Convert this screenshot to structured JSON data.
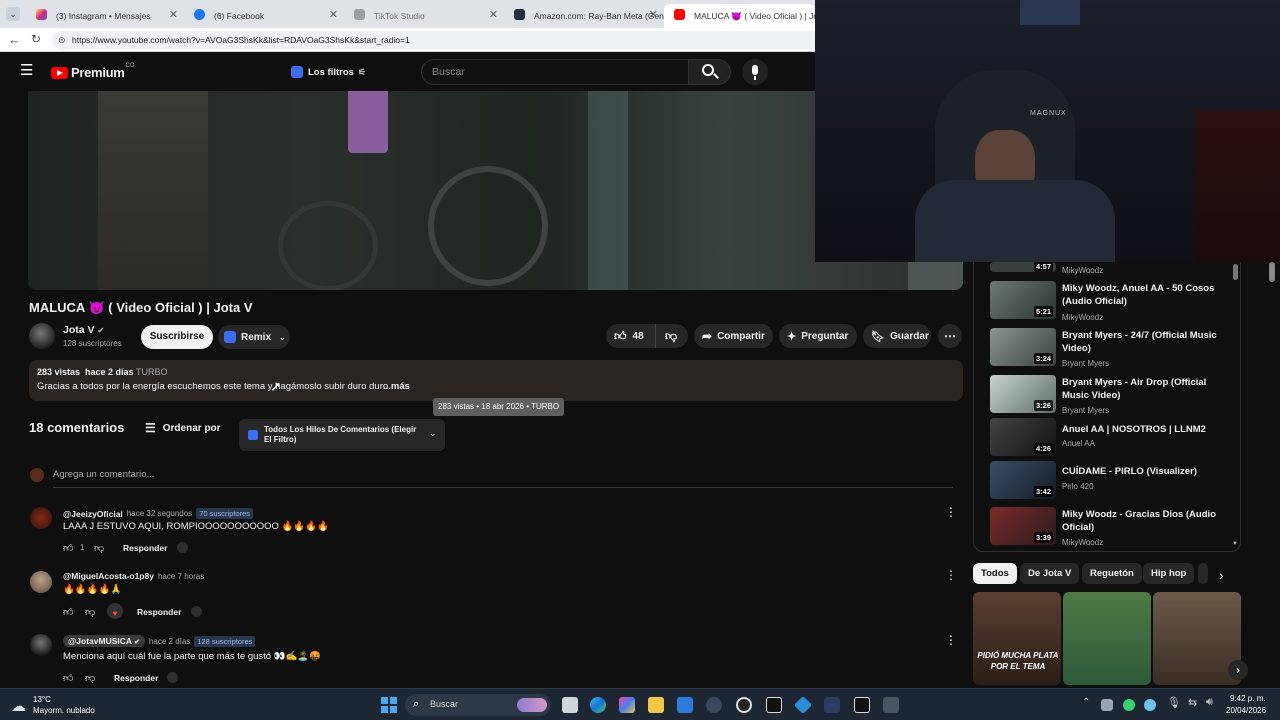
{
  "browser": {
    "tabs": [
      {
        "label": "(3) Instagram • Mensajes",
        "color": "#e1306c"
      },
      {
        "label": "(6) Facebook",
        "color": "#1877f2"
      },
      {
        "label": "TikTok Studio",
        "color": "#777777"
      },
      {
        "label": "Amazon.com: Ray-Ban Meta (Gen",
        "color": "#111111"
      },
      {
        "label": "MALUCA 😈 ( Video Oficial ) | Jota",
        "color": "#ff0000"
      }
    ],
    "url": "https://www.youtube.com/watch?v=AVOaG3ShsKk&list=RDAVOaG3ShsKk&start_radio=1"
  },
  "header": {
    "logo_text": "Premium",
    "logo_sup": "CO",
    "filter_label": "Los filtros",
    "search_placeholder": "Buscar"
  },
  "video": {
    "title": "MALUCA 😈 ( Video Oficial ) | Jota V",
    "channel": "Jota V",
    "subscribers": "128 suscriptores",
    "subscribe_label": "Suscribirse",
    "remix_label": "Remix",
    "likes": "48",
    "share_label": "Compartir",
    "ask_label": "Preguntar",
    "save_label": "Guardar"
  },
  "description": {
    "stats": "283 vistas  hace 2 días",
    "tag": "TURBO",
    "text": "Gracias a todos por la energía escuchemos este tema y hagámoslo subir duro duro",
    "more": "...más",
    "tooltip": "283 vistas • 18 abr 2026 • TURBO"
  },
  "comments_section": {
    "count_label": "18 comentarios",
    "sort_label": "Ordenar por",
    "filter_label": "Todos Los Hilos De Comentarios (Elegir El Filtro)",
    "add_placeholder": "Agrega un comentario...",
    "reply_label": "Responder",
    "items": [
      {
        "author": "@JeeizyOficial",
        "time": "hace 32 segundos",
        "badge": "70 suscriptores",
        "text": "LAAA J ESTUVO AQUI, ROMPIOOOOOOOOOOO 🔥🔥🔥🔥",
        "likes": "1"
      },
      {
        "author": "@MiguelAcosta-o1p8y",
        "time": "hace 7 horas",
        "badge": "",
        "text": "🔥🔥🔥🔥🙏",
        "likes": ""
      },
      {
        "author": "@JotavMUSICA",
        "time": "hace 2 días",
        "badge": "128 suscriptores",
        "text": "Menciona aquí cuál fue la parte que más te gustó 👀✍️🏝️🤬",
        "likes": ""
      }
    ]
  },
  "sidebar": {
    "items": [
      {
        "title": "",
        "channel": "MikyWoodz",
        "duration": "4:57"
      },
      {
        "title": "Miky Woodz, Anuel AA - 50 Cosos (Audio Oficial)",
        "channel": "MikyWoodz",
        "duration": "5:21"
      },
      {
        "title": "Bryant Myers - 24/7 (Official Music Video)",
        "channel": "Bryant Myers",
        "duration": "3:24"
      },
      {
        "title": "Bryant Myers - Air Drop (Official Music Video)",
        "channel": "Bryant Myers",
        "duration": "3:26"
      },
      {
        "title": "Anuel AA | NOSOTROS | LLNM2",
        "channel": "Anuel AA",
        "duration": "4:26"
      },
      {
        "title": "CUÍDAME - PIRLO (Visualizer)",
        "channel": "Pirlo 420",
        "duration": "3:42"
      },
      {
        "title": "Miky Woodz - Gracias Dios (Audio Oficial)",
        "channel": "MikyWoodz",
        "duration": "3:39"
      }
    ],
    "chips": [
      "Todos",
      "De Jota V",
      "Reguetón",
      "Hip hop"
    ],
    "shorts_caption": "PIDIÓ MUCHA PLATA POR EL TEMA"
  },
  "webcam": {
    "cap_text": "MAGNUX"
  },
  "taskbar": {
    "weather_temp": "13°C",
    "weather_desc": "Mayorm. nublado",
    "search_label": "Buscar",
    "time": "9:42 p. m.",
    "date": "20/04/2026"
  },
  "colors": {
    "accent_red": "#ff0000",
    "bg": "#0f0f0f",
    "badge_blue": "#263850"
  }
}
